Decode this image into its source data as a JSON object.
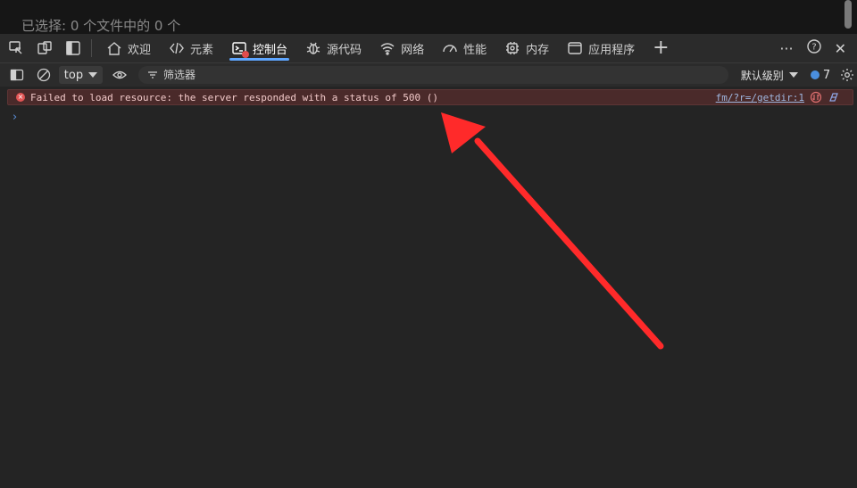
{
  "page": {
    "selection_text": "已选择: 0 个文件中的 0 个"
  },
  "devtools": {
    "tabs": [
      {
        "label": "欢迎",
        "icon": "home-icon"
      },
      {
        "label": "元素",
        "icon": "code-icon"
      },
      {
        "label": "控制台",
        "icon": "console-icon",
        "active": true
      },
      {
        "label": "源代码",
        "icon": "bug-icon"
      },
      {
        "label": "网络",
        "icon": "wifi-icon"
      },
      {
        "label": "性能",
        "icon": "gauge-icon"
      },
      {
        "label": "内存",
        "icon": "chip-icon"
      },
      {
        "label": "应用程序",
        "icon": "app-window-icon"
      }
    ],
    "more_label": "···",
    "help_label": "?",
    "close_label": "✕",
    "add_tab_label": "+"
  },
  "console_toolbar": {
    "context_value": "top",
    "filter_placeholder": "筛选器",
    "level_label": "默认级别",
    "issues_count": "7"
  },
  "console": {
    "error_message": "Failed to load resource: the server responded with a status of 500 ()",
    "error_source": "fm/?r=/getdir:1",
    "prompt_symbol": "›"
  },
  "colors": {
    "background": "#242424",
    "tabbar": "#2b2b2b",
    "error_row_bg": "#4a2a2a",
    "error_icon": "#e25555",
    "active_tab_underline": "#5ea6ff",
    "annotation_arrow": "#ff2a2a"
  }
}
